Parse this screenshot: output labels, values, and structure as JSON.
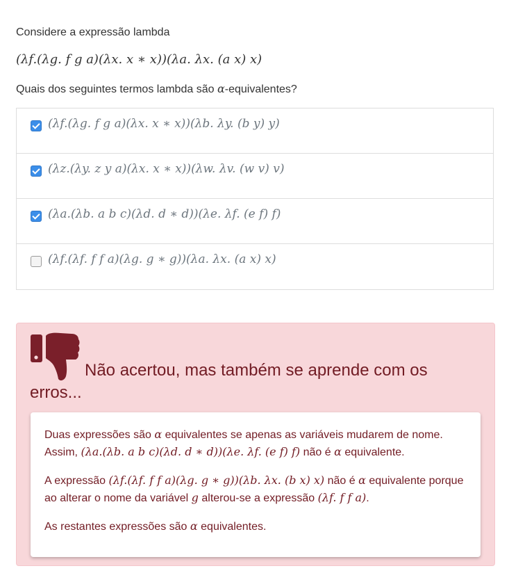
{
  "question": {
    "intro": "Considere a expressão lambda",
    "expression": "(λf.(λg. f g a)(λx. x ∗ x))(λa. λx. (a x) x)",
    "prompt_before": "Quais dos seguintes termos lambda são ",
    "prompt_symbol": "α",
    "prompt_after": "-equivalentes?"
  },
  "options": [
    {
      "text": "(λf.(λg. f g a)(λx. x ∗ x))(λb. λy. (b y) y)",
      "checked": true
    },
    {
      "text": "(λz.(λy. z y a)(λx. x ∗ x))(λw. λv. (w v) v)",
      "checked": true
    },
    {
      "text": "(λa.(λb. a b c)(λd. d ∗ d))(λe. λf. (e f) f)",
      "checked": true
    },
    {
      "text": "(λf.(λf. f f a)(λg. g ∗ g))(λa. λx. (a x) x)",
      "checked": false
    }
  ],
  "feedback": {
    "title": "Não acertou, mas também se aprende com os erros...",
    "icon": "thumbs-down-icon",
    "p1_a": "Duas expressões são ",
    "p1_alpha": "α",
    "p1_b": " equivalentes se apenas as variáveis mudarem de nome. Assim, ",
    "p1_expr": "(λa.(λb. a b c)(λd. d ∗ d))(λe. λf. (e f) f)",
    "p1_c": " não é ",
    "p1_alpha2": "α",
    "p1_d": " equivalente.",
    "p2_a": "A expressão ",
    "p2_expr": "(λf.(λf. f f a)(λg. g ∗ g))(λb. λx. (b x) x)",
    "p2_b": " não é ",
    "p2_alpha": "α",
    "p2_c": " equivalente porque ao alterar o nome da variável ",
    "p2_var": "g",
    "p2_d": " alterou-se a expressão ",
    "p2_expr2": "(λf. f f a)",
    "p2_e": ".",
    "p3_a": "As restantes expressões são ",
    "p3_alpha": "α",
    "p3_b": " equivalentes."
  },
  "colors": {
    "checkbox_checked": "#3b8ee9",
    "alert_bg": "#f8d7da",
    "alert_text": "#721c24"
  }
}
